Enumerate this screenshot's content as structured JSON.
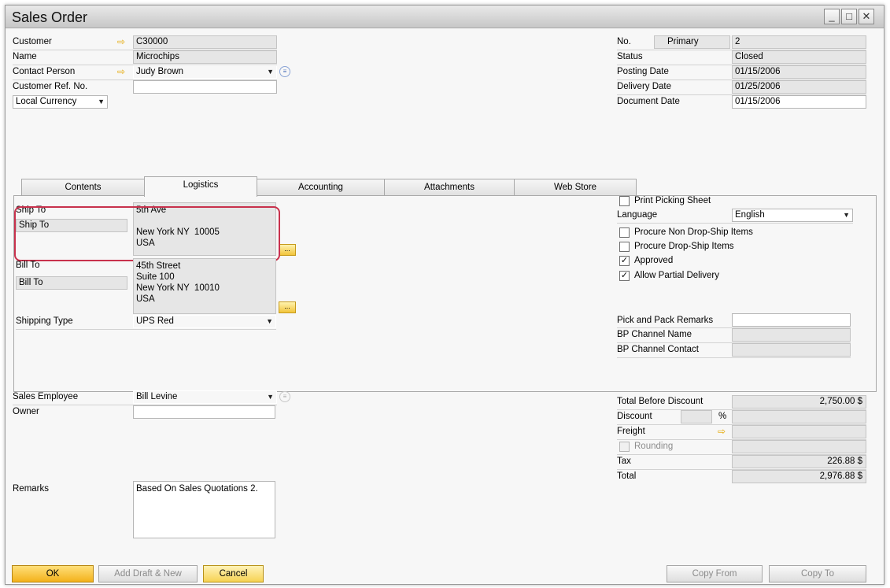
{
  "window": {
    "title": "Sales Order",
    "minimize_icon": "minimize-icon",
    "maximize_icon": "maximize-icon",
    "close_icon": "close-icon"
  },
  "header": {
    "customer_label": "Customer",
    "customer_value": "C30000",
    "name_label": "Name",
    "name_value": "Microchips",
    "contact_label": "Contact Person",
    "contact_value": "Judy Brown",
    "ref_label": "Customer Ref. No.",
    "ref_value": "",
    "currency_value": "Local Currency",
    "no_label": "No.",
    "series_value": "Primary",
    "no_value": "2",
    "status_label": "Status",
    "status_value": "Closed",
    "posting_label": "Posting Date",
    "posting_value": "01/15/2006",
    "delivery_label": "Delivery Date",
    "delivery_value": "01/25/2006",
    "document_label": "Document Date",
    "document_value": "01/15/2006"
  },
  "tabs": [
    {
      "label": "Contents"
    },
    {
      "label": "Logistics"
    },
    {
      "label": "Accounting"
    },
    {
      "label": "Attachments"
    },
    {
      "label": "Web Store"
    }
  ],
  "logistics": {
    "ship_to_label": "Ship To",
    "ship_to_select": "Ship To",
    "ship_to_address": "5th Ave\n\nNew York NY  10005\nUSA",
    "bill_to_label": "Bill To",
    "bill_to_select": "Bill To",
    "bill_to_address": "45th Street\nSuite 100\nNew York NY  10010\nUSA",
    "browse_label": "...",
    "shipping_type_label": "Shipping Type",
    "shipping_type_value": "UPS Red",
    "print_picking_label": "Print Picking Sheet",
    "language_label": "Language",
    "language_value": "English",
    "procure_non_label": "Procure Non Drop-Ship Items",
    "procure_drop_label": "Procure Drop-Ship Items",
    "approved_label": "Approved",
    "partial_label": "Allow Partial Delivery",
    "pick_pack_label": "Pick and Pack Remarks",
    "bp_channel_name_label": "BP Channel Name",
    "bp_channel_contact_label": "BP Channel Contact",
    "print_picking_checked": false,
    "procure_non_checked": false,
    "procure_drop_checked": false,
    "approved_checked": true,
    "partial_checked": true
  },
  "footer": {
    "sales_employee_label": "Sales Employee",
    "sales_employee_value": "Bill Levine",
    "owner_label": "Owner",
    "owner_value": "",
    "remarks_label": "Remarks",
    "remarks_value": "Based On Sales Quotations 2.",
    "total_before_discount_label": "Total Before Discount",
    "total_before_discount_value": "2,750.00 $",
    "discount_label": "Discount",
    "discount_pct_symbol": "%",
    "freight_label": "Freight",
    "rounding_label": "Rounding",
    "tax_label": "Tax",
    "tax_value": "226.88 $",
    "total_label": "Total",
    "total_value": "2,976.88 $"
  },
  "buttons": {
    "ok": "OK",
    "add_draft": "Add Draft & New",
    "cancel": "Cancel",
    "copy_from": "Copy From",
    "copy_to": "Copy To"
  },
  "colors": {
    "accent_yellow": "#f3b11b",
    "highlight_red": "#c8314c",
    "link_arrow": "#e5a700"
  }
}
